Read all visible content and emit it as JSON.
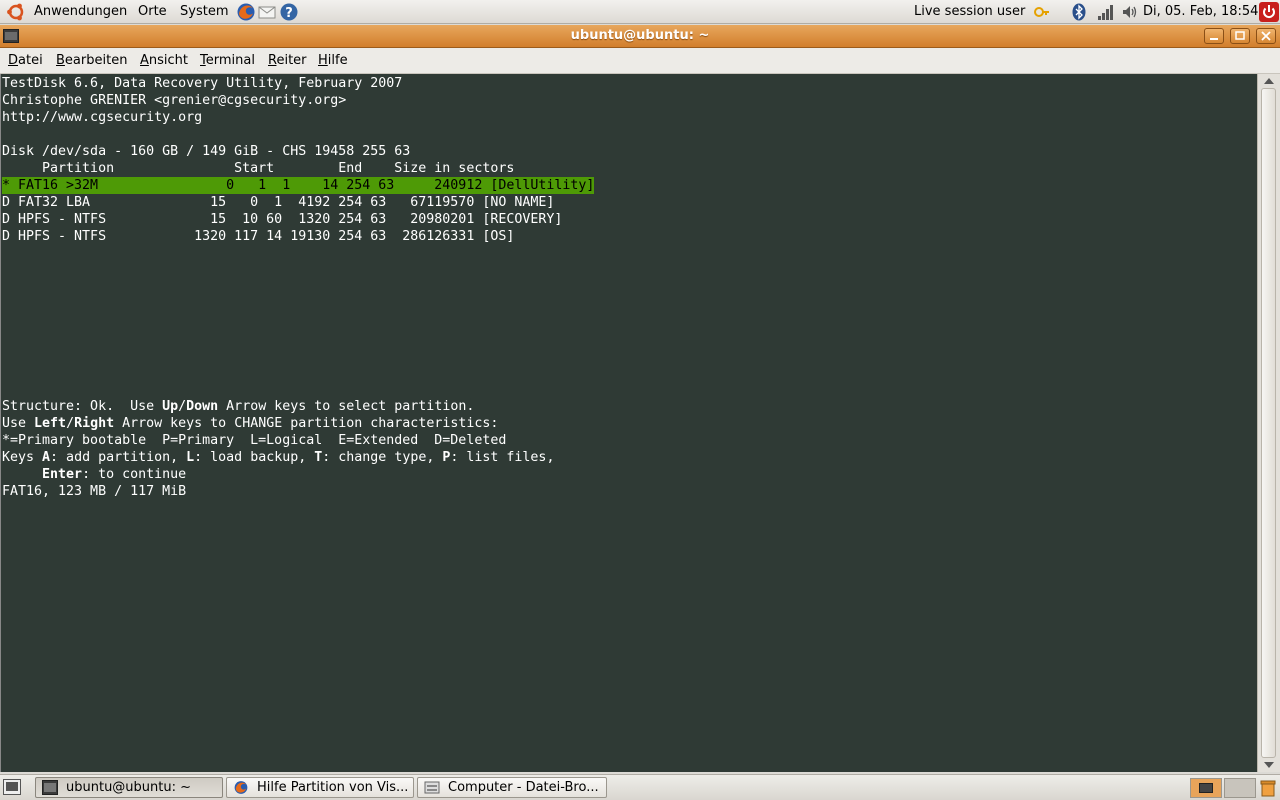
{
  "top_panel": {
    "menus": [
      "Anwendungen",
      "Orte",
      "System"
    ],
    "user": "Live session user",
    "clock": "Di, 05. Feb, 18:54"
  },
  "window": {
    "title": "ubuntu@ubuntu: ~"
  },
  "menubar": {
    "items": [
      {
        "u": "D",
        "rest": "atei"
      },
      {
        "u": "B",
        "rest": "earbeiten"
      },
      {
        "u": "A",
        "rest": "nsicht"
      },
      {
        "u": "T",
        "rest": "erminal"
      },
      {
        "u": "R",
        "rest": "eiter"
      },
      {
        "u": "H",
        "rest": "ilfe"
      }
    ]
  },
  "terminal": {
    "header": [
      "TestDisk 6.6, Data Recovery Utility, February 2007",
      "Christophe GRENIER <grenier@cgsecurity.org>",
      "http://www.cgsecurity.org"
    ],
    "disk_line": "Disk /dev/sda - 160 GB / 149 GiB - CHS 19458 255 63",
    "column_header": "     Partition               Start        End    Size in sectors",
    "partitions": [
      "* FAT16 >32M                0   1  1    14 254 63     240912 [DellUtility]",
      "D FAT32 LBA               15   0  1  4192 254 63   67119570 [NO NAME]",
      "D HPFS - NTFS             15  10 60  1320 254 63   20980201 [RECOVERY]",
      "D HPFS - NTFS           1320 117 14 19130 254 63  286126331 [OS]"
    ],
    "help": {
      "l1a": "Structure: Ok.  Use ",
      "l1b": "Up",
      "l1c": "/",
      "l1d": "Down",
      "l1e": " Arrow keys to select partition.",
      "l2a": "Use ",
      "l2b": "Left",
      "l2c": "/",
      "l2d": "Right",
      "l2e": " Arrow keys to CHANGE partition characteristics:",
      "l3": "*=Primary bootable  P=Primary  L=Logical  E=Extended  D=Deleted",
      "l4a": "Keys ",
      "l4b": "A",
      "l4c": ": add partition, ",
      "l4d": "L",
      "l4e": ": load backup, ",
      "l4f": "T",
      "l4g": ": change type, ",
      "l4h": "P",
      "l4i": ": list files,",
      "l5a": "     ",
      "l5b": "Enter",
      "l5c": ": to continue"
    },
    "status": "FAT16, 123 MB / 117 MiB",
    "highlight_color": "#4e9a06"
  },
  "taskbar": {
    "tasks": [
      "ubuntu@ubuntu: ~",
      "Hilfe Partition von Vis...",
      "Computer - Datei-Bro..."
    ]
  }
}
